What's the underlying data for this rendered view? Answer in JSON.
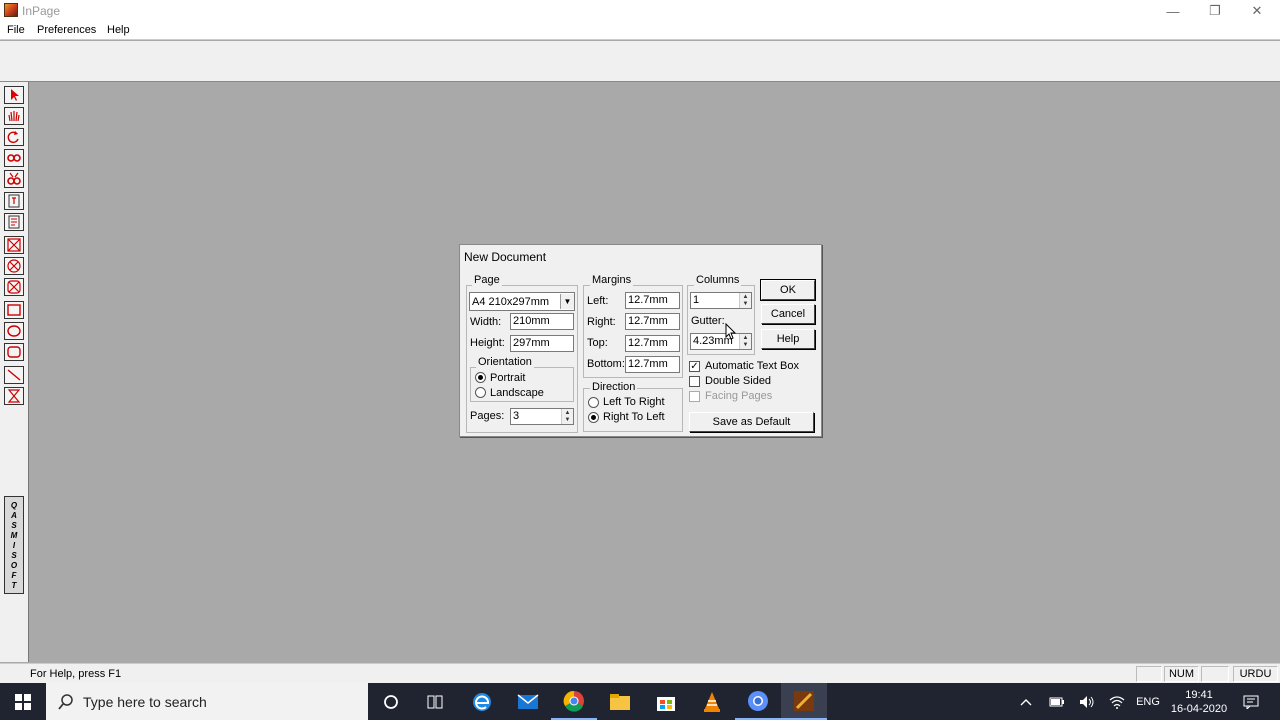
{
  "window": {
    "title": "InPage",
    "minimize": "—",
    "restore": "❐",
    "close": "✕"
  },
  "menu": {
    "items": [
      "File",
      "Preferences",
      "Help"
    ]
  },
  "palette": {
    "logo_letters": [
      "Q",
      "A",
      "S",
      "M",
      "I",
      "S",
      "O",
      "F",
      "T"
    ]
  },
  "status": {
    "help_text": "For Help, press F1",
    "num": "NUM",
    "lang": "URDU"
  },
  "dialog": {
    "title": "New Document",
    "page": {
      "group_label": "Page",
      "size_value": "A4 210x297mm",
      "width_label": "Width:",
      "width_value": "210mm",
      "height_label": "Height:",
      "height_value": "297mm",
      "orientation_label": "Orientation",
      "portrait_label": "Portrait",
      "landscape_label": "Landscape",
      "orientation_selected": "Portrait",
      "pages_label": "Pages:",
      "pages_value": "3"
    },
    "margins": {
      "group_label": "Margins",
      "left_label": "Left:",
      "left_value": "12.7mm",
      "right_label": "Right:",
      "right_value": "12.7mm",
      "top_label": "Top:",
      "top_value": "12.7mm",
      "bottom_label": "Bottom:",
      "bottom_value": "12.7mm"
    },
    "direction": {
      "group_label": "Direction",
      "ltr_label": "Left To Right",
      "rtl_label": "Right To Left",
      "selected": "Right To Left"
    },
    "columns": {
      "group_label": "Columns",
      "columns_value": "1",
      "gutter_label": "Gutter:",
      "gutter_value": "4.23mm"
    },
    "options": {
      "auto_text_box": "Automatic Text Box",
      "auto_text_box_checked": true,
      "double_sided": "Double Sided",
      "double_sided_checked": false,
      "facing_pages": "Facing Pages",
      "facing_pages_enabled": false
    },
    "buttons": {
      "ok": "OK",
      "cancel": "Cancel",
      "help": "Help",
      "save_default": "Save as Default"
    }
  },
  "taskbar": {
    "search_placeholder": "Type here to search",
    "lang": "ENG",
    "time": "19:41",
    "date": "16-04-2020"
  }
}
